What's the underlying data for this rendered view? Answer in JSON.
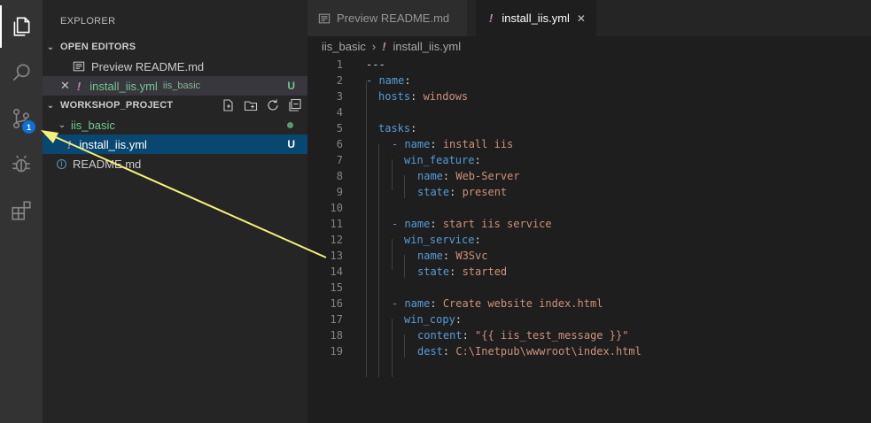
{
  "sidebar": {
    "title": "EXPLORER",
    "open_editors": {
      "header": "OPEN EDITORS",
      "items": [
        {
          "label": "Preview README.md"
        },
        {
          "label": "install_iis.yml",
          "folder": "iis_basic",
          "status": "U"
        }
      ]
    },
    "project": {
      "header": "WORKSHOP_PROJECT",
      "folder": "iis_basic",
      "file": "install_iis.yml",
      "file_status": "U",
      "readme": "README.md"
    }
  },
  "activity": {
    "source_control_badge": "1"
  },
  "tabs": [
    {
      "label": "Preview README.md",
      "active": false
    },
    {
      "label": "install_iis.yml",
      "active": true
    }
  ],
  "breadcrumb": {
    "folder": "iis_basic",
    "file": "install_iis.yml"
  },
  "code": {
    "line_numbers": [
      "1",
      "2",
      "3",
      "4",
      "5",
      "6",
      "7",
      "8",
      "9",
      "10",
      "11",
      "12",
      "13",
      "14",
      "15",
      "16",
      "17",
      "18",
      "19"
    ],
    "l1": "---",
    "l2_dash": "- ",
    "l2_key": "name",
    "l2_colon": ":",
    "l3_key": "hosts",
    "l3_colon": ": ",
    "l3_val": "windows",
    "l5_key": "tasks",
    "l5_colon": ":",
    "l6_dash": "- ",
    "l6_key": "name",
    "l6_colon": ": ",
    "l6_val": "install iis",
    "l7_key": "win_feature",
    "l7_colon": ":",
    "l8_key": "name",
    "l8_colon": ": ",
    "l8_val": "Web-Server",
    "l9_key": "state",
    "l9_colon": ": ",
    "l9_val": "present",
    "l11_dash": "- ",
    "l11_key": "name",
    "l11_colon": ": ",
    "l11_val": "start iis service",
    "l12_key": "win_service",
    "l12_colon": ":",
    "l13_key": "name",
    "l13_colon": ": ",
    "l13_val": "W3Svc",
    "l14_key": "state",
    "l14_colon": ": ",
    "l14_val": "started",
    "l16_dash": "- ",
    "l16_key": "name",
    "l16_colon": ": ",
    "l16_val": "Create website index.html",
    "l17_key": "win_copy",
    "l17_colon": ":",
    "l18_key": "content",
    "l18_colon": ": ",
    "l18_val": "\"{{ iis_test_message }}\"",
    "l19_key": "dest",
    "l19_colon": ": ",
    "l19_val": "C:\\Inetpub\\wwwroot\\index.html"
  },
  "colors": {
    "annotation_arrow": "#f5f07a",
    "accent_badge": "#0e6fd8",
    "untracked": "#73c991"
  }
}
